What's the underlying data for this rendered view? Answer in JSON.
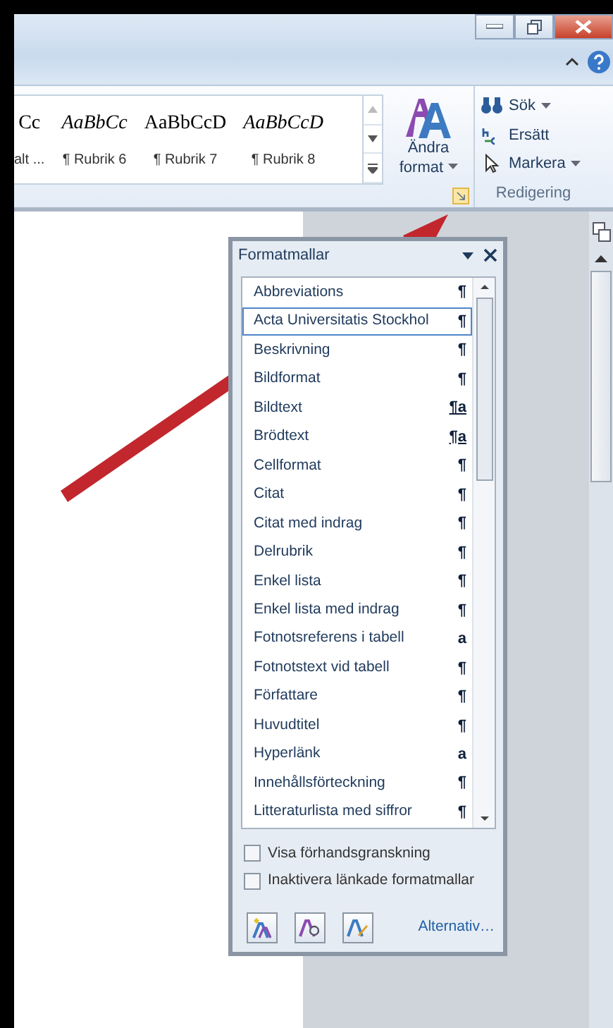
{
  "ribbon": {
    "gallery": [
      {
        "sample": "Cc",
        "label": "alt ...",
        "italic": false
      },
      {
        "sample": "AaBbCc",
        "label": "¶ Rubrik 6",
        "italic": true
      },
      {
        "sample": "AaBbCcD",
        "label": "¶ Rubrik 7",
        "italic": false
      },
      {
        "sample": "AaBbCcD",
        "label": "¶ Rubrik 8",
        "italic": true
      }
    ],
    "change_styles": {
      "label": "Ändra format"
    },
    "editing": {
      "group": "Redigering",
      "items": [
        {
          "label": "Sök",
          "dropdown": true
        },
        {
          "label": "Ersätt",
          "dropdown": false
        },
        {
          "label": "Markera",
          "dropdown": true
        }
      ]
    }
  },
  "styles_pane": {
    "title": "Formatmallar",
    "items": [
      {
        "name": "Abbreviations",
        "symbol": "¶",
        "kind": "paragraph",
        "selected": false
      },
      {
        "name": "Acta Universitatis Stockhol",
        "symbol": "¶",
        "kind": "paragraph",
        "selected": true
      },
      {
        "name": "Beskrivning",
        "symbol": "¶",
        "kind": "paragraph",
        "selected": false
      },
      {
        "name": "Bildformat",
        "symbol": "¶",
        "kind": "paragraph",
        "selected": false
      },
      {
        "name": "Bildtext",
        "symbol": "¶a",
        "kind": "linked",
        "selected": false
      },
      {
        "name": "Brödtext",
        "symbol": "¶a",
        "kind": "linked",
        "selected": false
      },
      {
        "name": "Cellformat",
        "symbol": "¶",
        "kind": "paragraph",
        "selected": false
      },
      {
        "name": "Citat",
        "symbol": "¶",
        "kind": "paragraph",
        "selected": false
      },
      {
        "name": "Citat med indrag",
        "symbol": "¶",
        "kind": "paragraph",
        "selected": false
      },
      {
        "name": "Delrubrik",
        "symbol": "¶",
        "kind": "paragraph",
        "selected": false
      },
      {
        "name": "Enkel lista",
        "symbol": "¶",
        "kind": "paragraph",
        "selected": false
      },
      {
        "name": "Enkel lista med indrag",
        "symbol": "¶",
        "kind": "paragraph",
        "selected": false
      },
      {
        "name": "Fotnotsreferens i tabell",
        "symbol": "a",
        "kind": "character",
        "selected": false
      },
      {
        "name": "Fotnotstext vid tabell",
        "symbol": "¶",
        "kind": "paragraph",
        "selected": false
      },
      {
        "name": "Författare",
        "symbol": "¶",
        "kind": "paragraph",
        "selected": false
      },
      {
        "name": "Huvudtitel",
        "symbol": "¶",
        "kind": "paragraph",
        "selected": false
      },
      {
        "name": "Hyperlänk",
        "symbol": "a",
        "kind": "character",
        "selected": false
      },
      {
        "name": "Innehållsförteckning",
        "symbol": "¶",
        "kind": "paragraph",
        "selected": false
      },
      {
        "name": "Litteraturlista med siffror",
        "symbol": "¶",
        "kind": "paragraph",
        "selected": false
      }
    ],
    "options": [
      {
        "label": "Visa förhandsgranskning",
        "checked": false
      },
      {
        "label": "Inaktivera länkade formatmallar",
        "checked": false
      }
    ],
    "link": "Alternativ…"
  }
}
